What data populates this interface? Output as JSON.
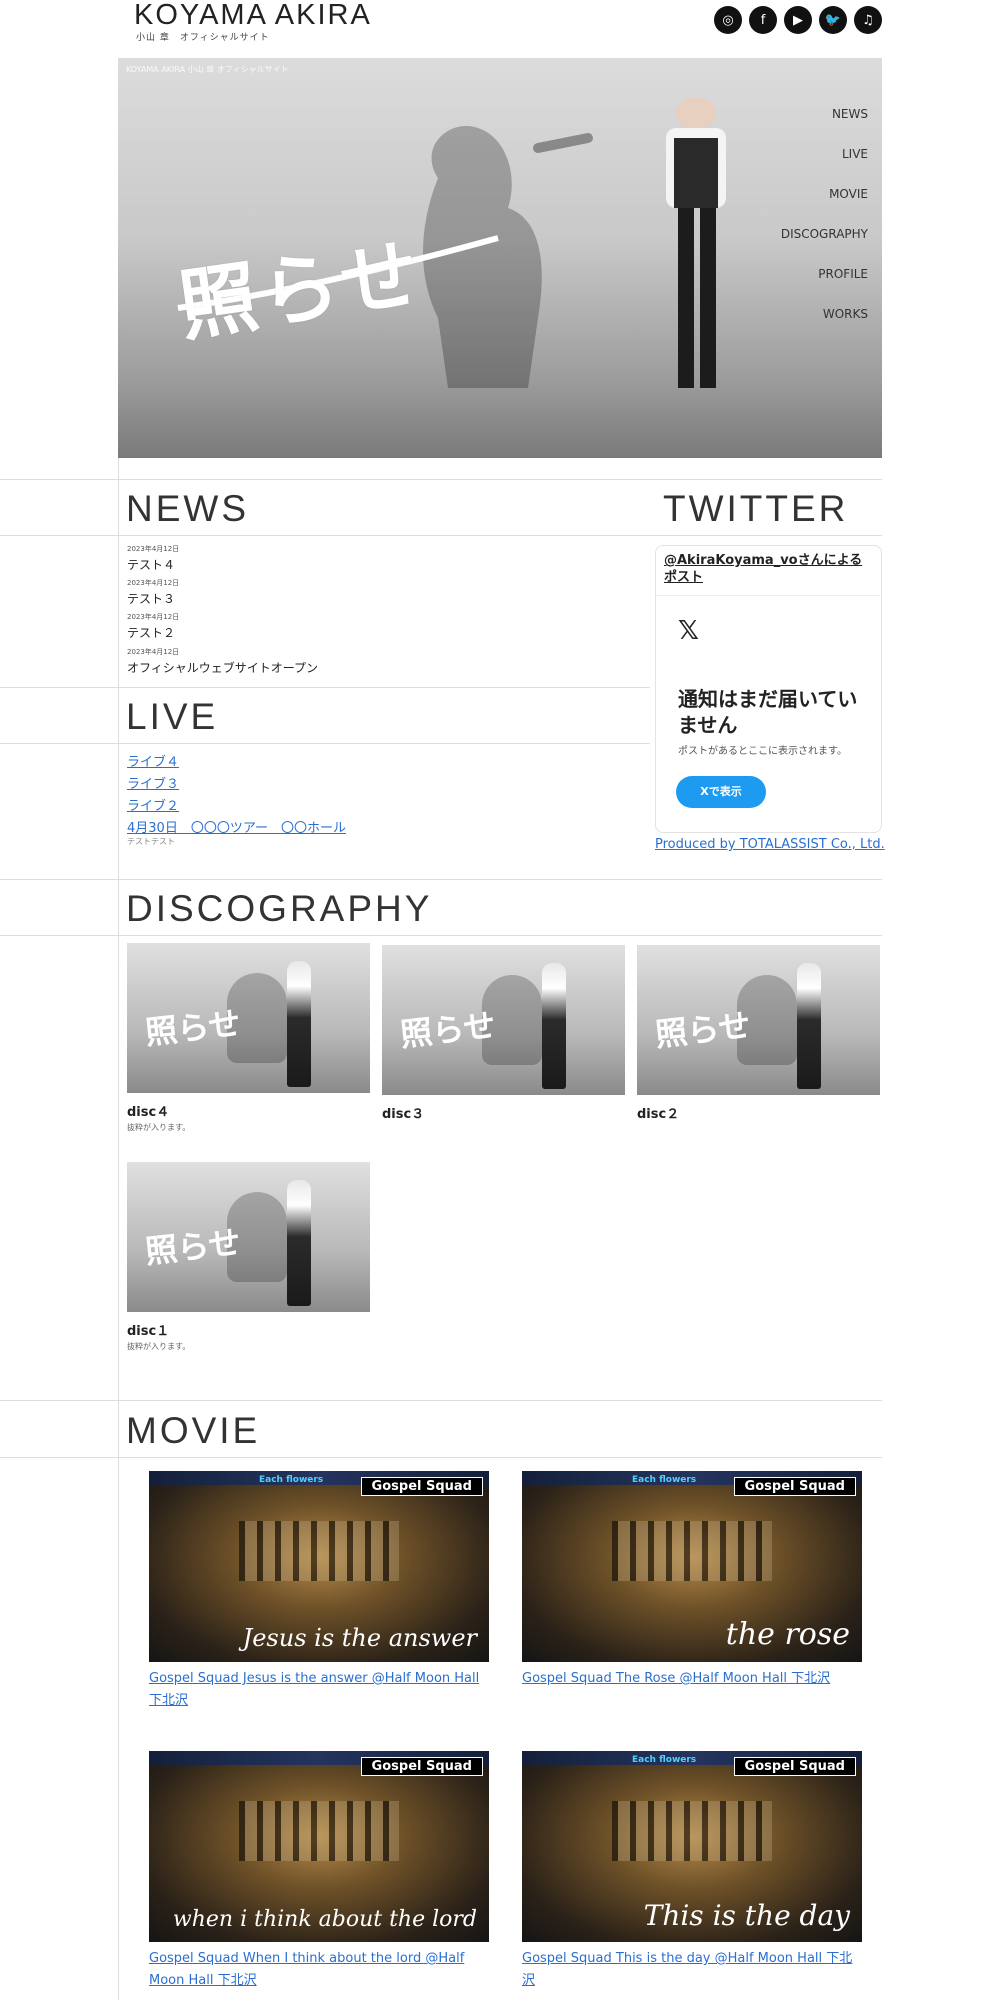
{
  "header": {
    "logo_main": "KOYAMA AKIRA",
    "logo_sub": "小山 章　オフィシャルサイト",
    "social": [
      {
        "icon": "instagram-icon",
        "glyph": "◎"
      },
      {
        "icon": "facebook-icon",
        "glyph": "f"
      },
      {
        "icon": "youtube-icon",
        "glyph": "▶"
      },
      {
        "icon": "twitter-icon",
        "glyph": "🐦"
      },
      {
        "icon": "music-icon",
        "glyph": "♫"
      }
    ]
  },
  "hero": {
    "caption": "KOYAMA AKIRA 小山 章 オフィシャルサイト",
    "title": "照らせ",
    "nav": [
      "NEWS",
      "LIVE",
      "MOVIE",
      "DISCOGRAPHY",
      "PROFILE",
      "WORKS"
    ]
  },
  "news": {
    "title": "NEWS",
    "items": [
      {
        "date": "2023年4月12日",
        "text": "テスト４"
      },
      {
        "date": "2023年4月12日",
        "text": "テスト３"
      },
      {
        "date": "2023年4月12日",
        "text": "テスト２"
      },
      {
        "date": "2023年4月12日",
        "text": "オフィシャルウェブサイトオープン"
      }
    ]
  },
  "live": {
    "title": "LIVE",
    "items": [
      "ライブ４",
      "ライブ３",
      "ライブ２",
      "4月30日　〇〇〇ツアー　〇〇ホール"
    ],
    "note": "テストテスト"
  },
  "twitter": {
    "title": "TWITTER",
    "header": "@AkiraKoyama_voさんによるポスト",
    "x_logo": "𝕏",
    "message": "通知はまだ届いていません",
    "sub": "ポストがあるとここに表示されます。",
    "button": "Xで表示",
    "credit": "Produced by TOTALASSIST Co., Ltd."
  },
  "discography": {
    "title": "DISCOGRAPHY",
    "items": [
      {
        "title": "disc４",
        "note": "抜粋が入ります。",
        "art": "照らせ"
      },
      {
        "title": "disc３",
        "note": "",
        "art": "照らせ"
      },
      {
        "title": "disc２",
        "note": "",
        "art": "照らせ"
      },
      {
        "title": "disc１",
        "note": "抜粋が入ります。",
        "art": "照らせ"
      }
    ]
  },
  "movie": {
    "title": "MOVIE",
    "items": [
      {
        "badge": "Gospel Squad",
        "flowers": "Each flowers",
        "script": "Jesus is the answer",
        "caption": "Gospel Squad Jesus is the answer @Half Moon Hall 下北沢"
      },
      {
        "badge": "Gospel Squad",
        "flowers": "Each flowers",
        "script": "the rose",
        "caption": "Gospel Squad The Rose @Half Moon Hall 下北沢"
      },
      {
        "badge": "Gospel Squad",
        "flowers": "",
        "script": "when i think about the lord",
        "caption": "Gospel Squad When I think about the lord @Half Moon Hall 下北沢"
      },
      {
        "badge": "Gospel Squad",
        "flowers": "Each flowers",
        "script": "This is the day",
        "caption": "Gospel Squad This is the day @Half Moon Hall 下北沢"
      }
    ]
  }
}
